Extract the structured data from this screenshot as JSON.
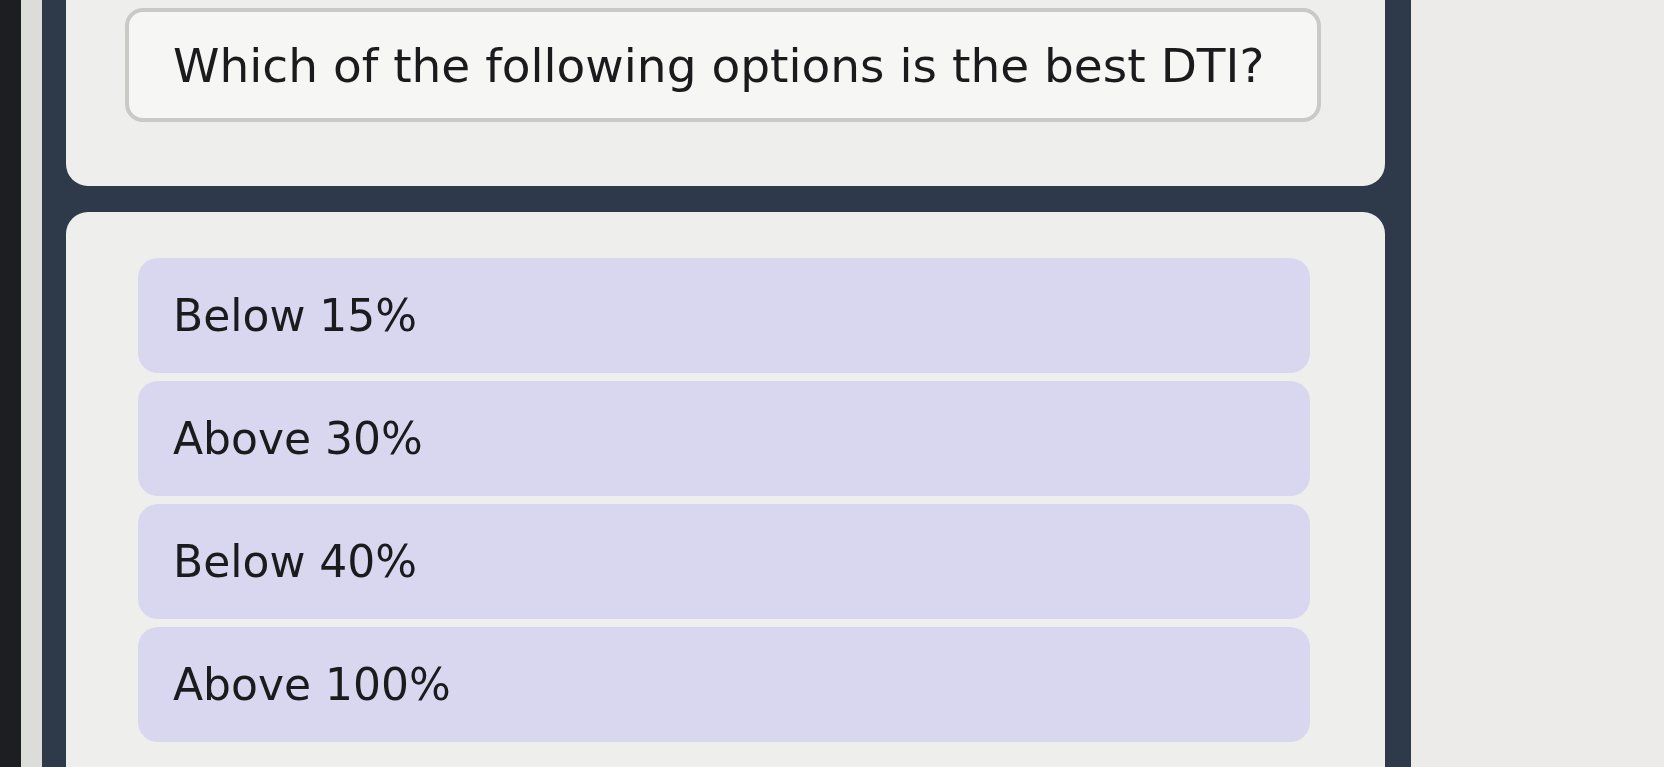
{
  "question": "Which of the following options is the best DTI?",
  "options": [
    {
      "label": "Below 15%",
      "selected": false
    },
    {
      "label": "Above 30%",
      "selected": false
    },
    {
      "label": "Below 40%",
      "selected": false
    },
    {
      "label": "Above 100%",
      "selected": false
    }
  ]
}
